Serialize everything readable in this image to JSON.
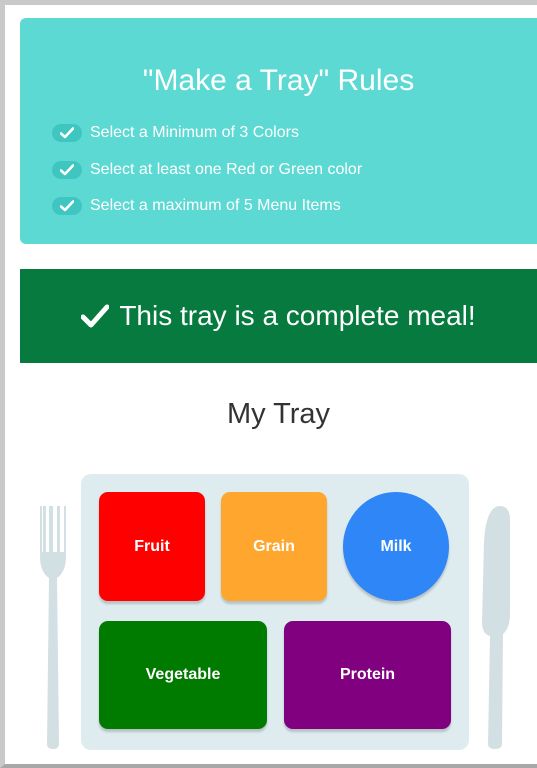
{
  "rules": {
    "title": "\"Make a Tray\" Rules",
    "items": [
      "Select a Minimum of 3 Colors",
      "Select at least one Red or Green color",
      "Select a maximum of 5 Menu Items"
    ]
  },
  "status": {
    "message": "This tray is a complete meal!"
  },
  "tray": {
    "title": "My Tray",
    "items": [
      {
        "label": "Fruit",
        "color": "#ff0000"
      },
      {
        "label": "Grain",
        "color": "#ffa62e"
      },
      {
        "label": "Milk",
        "color": "#2f86f6"
      },
      {
        "label": "Vegetable",
        "color": "#007b00"
      },
      {
        "label": "Protein",
        "color": "#800080"
      }
    ]
  },
  "colors": {
    "rules_bg": "#5dd9d4",
    "banner_bg": "#077a40",
    "tray_bg": "#deecf0",
    "utensil": "#d3e0e3"
  },
  "icons": [
    "check-icon",
    "fork-icon",
    "knife-icon"
  ]
}
